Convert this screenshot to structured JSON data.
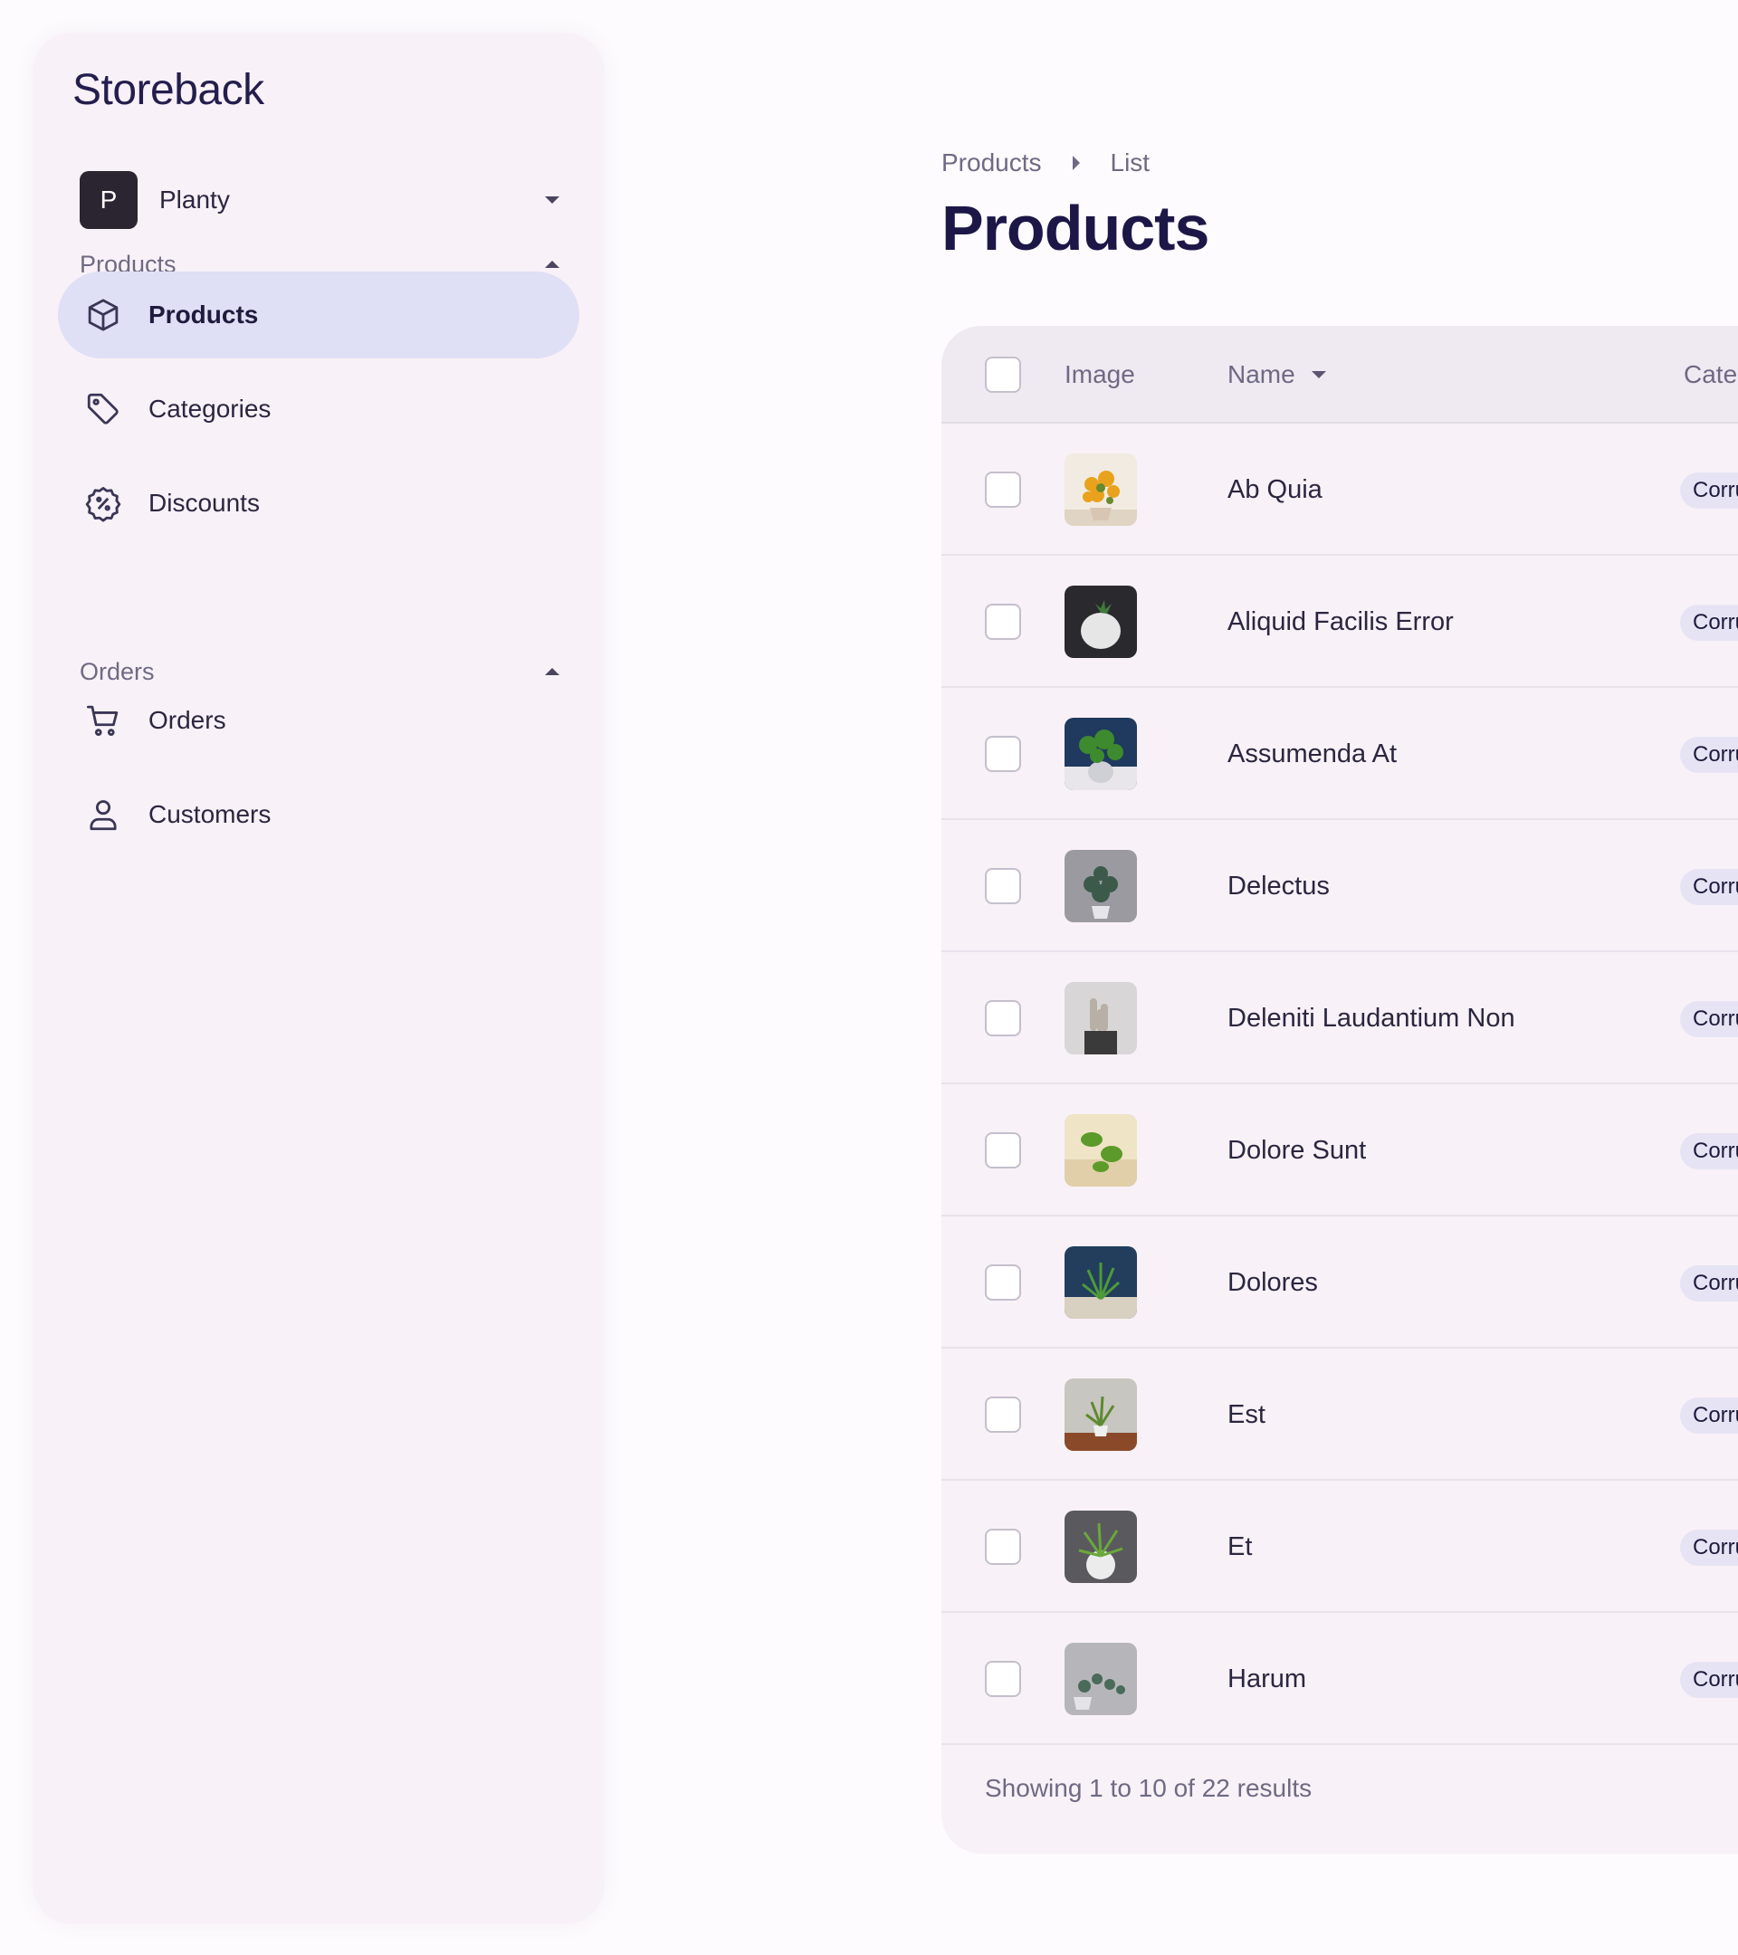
{
  "sidebar": {
    "app_title": "Storeback",
    "store": {
      "initial": "P",
      "name": "Planty"
    },
    "sections": [
      {
        "label": "Products",
        "items": [
          {
            "label": "Products",
            "icon": "box-icon",
            "active": true
          },
          {
            "label": "Categories",
            "icon": "tag-icon",
            "active": false
          },
          {
            "label": "Discounts",
            "icon": "discount-badge-icon",
            "active": false
          }
        ]
      },
      {
        "label": "Orders",
        "items": [
          {
            "label": "Orders",
            "icon": "cart-icon",
            "active": false
          },
          {
            "label": "Customers",
            "icon": "user-icon",
            "active": false
          }
        ]
      }
    ]
  },
  "breadcrumb": [
    "Products",
    "List"
  ],
  "page_title": "Products",
  "table": {
    "columns": [
      "Image",
      "Name",
      "Cate"
    ],
    "sort_column": "Name",
    "rows": [
      {
        "name": "Ab Quia",
        "category": "Corru"
      },
      {
        "name": "Aliquid Facilis Error",
        "category": "Corru"
      },
      {
        "name": "Assumenda At",
        "category": "Corru"
      },
      {
        "name": "Delectus",
        "category": "Corru"
      },
      {
        "name": "Deleniti Laudantium Non",
        "category": "Corru"
      },
      {
        "name": "Dolore Sunt",
        "category": "Corru"
      },
      {
        "name": "Dolores",
        "category": "Corru"
      },
      {
        "name": "Est",
        "category": "Corru"
      },
      {
        "name": "Et",
        "category": "Corru"
      },
      {
        "name": "Harum",
        "category": "Corru"
      }
    ],
    "footer": "Showing 1 to 10 of 22 results"
  },
  "colors": {
    "sidebar_bg": "#f8f1f7",
    "active_nav_bg": "#dfdff5",
    "title": "#1c1747",
    "muted": "#6e6a84"
  }
}
